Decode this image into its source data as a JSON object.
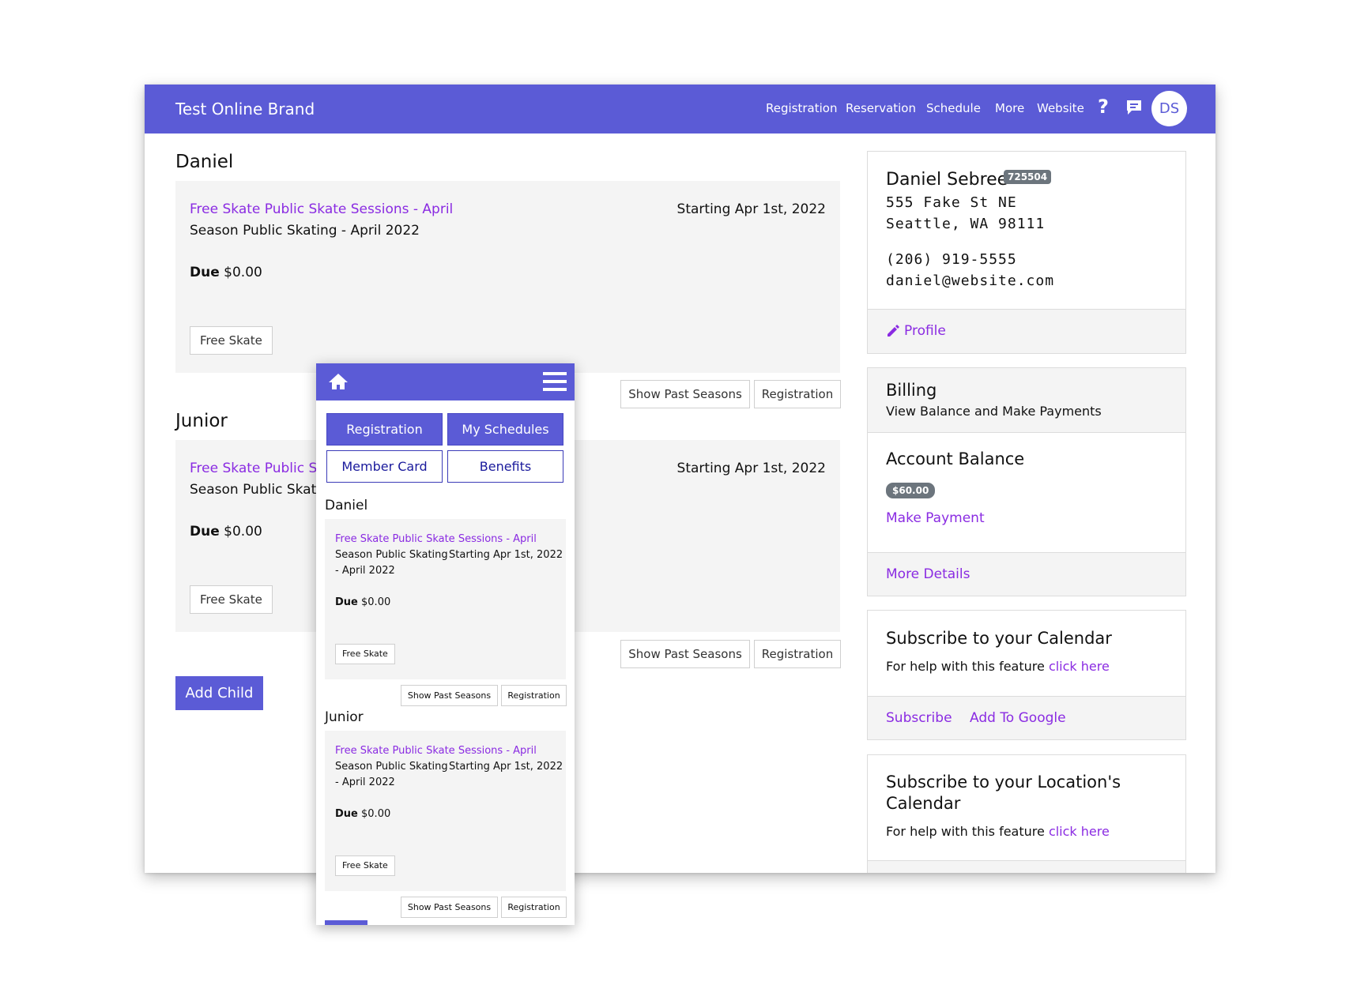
{
  "header": {
    "brand": "Test Online Brand",
    "nav": [
      "Registration",
      "Reservation",
      "Schedule",
      "More",
      "Website"
    ],
    "avatar_initials": "DS"
  },
  "children": [
    {
      "name": "Daniel",
      "program": "Free Skate Public Skate Sessions - April",
      "season": "Season Public Skating - April 2022",
      "start": "Starting Apr 1st, 2022",
      "due_label": "Due",
      "due_amount": "$0.00",
      "tag": "Free Skate"
    },
    {
      "name": "Junior",
      "program": "Free Skate Public Sk",
      "season": "Season Public Skati",
      "start": "Starting Apr 1st, 2022",
      "due_label": "Due",
      "due_amount": "$0.00",
      "tag": "Free Skate"
    }
  ],
  "actions": {
    "show_past": "Show Past Seasons",
    "registration": "Registration",
    "add_child": "Add Child"
  },
  "profile": {
    "name": "Daniel Sebree",
    "id_badge": "725504",
    "street": "555 Fake St NE",
    "city": "Seattle, WA 98111",
    "phone": "(206) 919-5555",
    "email": "daniel@website.com",
    "profile_link": "Profile"
  },
  "billing": {
    "title": "Billing",
    "subtitle": "View Balance and Make Payments",
    "balance_title": "Account Balance",
    "balance": "$60.00",
    "make_payment": "Make Payment",
    "more_details": "More Details"
  },
  "calendar": {
    "title": "Subscribe to your Calendar",
    "help_prefix": "For help with this feature",
    "help_link": "click here",
    "subscribe": "Subscribe",
    "add_google": "Add To Google"
  },
  "location_calendar": {
    "title_line1": "Subscribe to your Location's",
    "title_line2": "Calendar",
    "help_prefix": "For help with this feature",
    "help_link": "click here"
  },
  "mobile": {
    "buttons": [
      "Registration",
      "My Schedules",
      "Member Card",
      "Benefits"
    ],
    "children": [
      {
        "name": "Daniel",
        "program": "Free Skate Public Skate Sessions - April",
        "season_line1": "Season Public Skating",
        "season_line2": "- April 2022",
        "start": "Starting Apr 1st, 2022",
        "due_label": "Due",
        "due_amount": "$0.00",
        "tag": "Free Skate"
      },
      {
        "name": "Junior",
        "program": "Free Skate Public Skate Sessions - April",
        "season_line1": "Season Public Skating",
        "season_line2": "- April 2022",
        "start": "Starting Apr 1st, 2022",
        "due_label": "Due",
        "due_amount": "$0.00",
        "tag": "Free Skate"
      }
    ],
    "show_past": "Show Past Seasons",
    "registration": "Registration"
  },
  "colors": {
    "brand": "#5b5bd6",
    "link": "#8a2be2",
    "card_bg": "#f4f4f4"
  }
}
